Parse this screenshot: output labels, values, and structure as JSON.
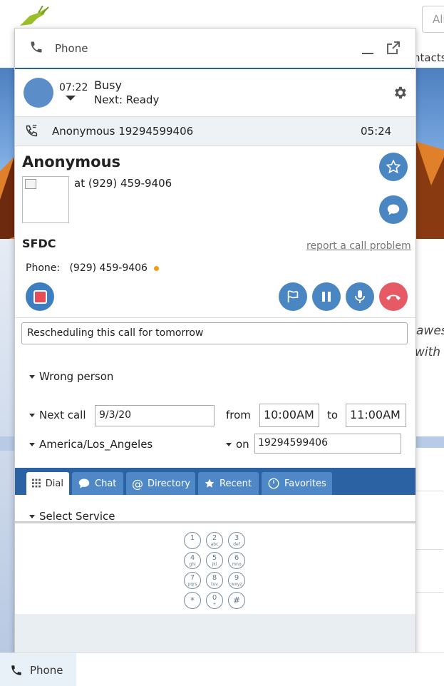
{
  "background": {
    "search_placeholder": "All",
    "nav_text": "ntacts",
    "italic_line1": "awes",
    "italic_line2": "with"
  },
  "softphone": {
    "title": "Phone",
    "agent": {
      "time": "07:22",
      "status": "Busy",
      "next_status": "Next: Ready"
    },
    "call": {
      "caller": "Anonymous 19294599406",
      "duration": "05:24"
    },
    "contact": {
      "name": "Anonymous",
      "number_line": "at (929) 459-9406",
      "source": "SFDC",
      "report_link": "report a call problem",
      "phone_label": "Phone:",
      "phone_value": "(929) 459-9406"
    },
    "notes_value": "Rescheduling this call for tomorrow",
    "disposition": "Wrong person",
    "callback": {
      "next_call_label": "Next call",
      "date": "9/3/20",
      "from_label": "from",
      "from_time": "10:00AM",
      "to_label": "to",
      "to_time": "11:00AM",
      "timezone": "America/Los_Angeles",
      "on_label": "on",
      "on_number": "19294599406"
    },
    "tabs": [
      {
        "label": "Dial",
        "icon": "grid-icon"
      },
      {
        "label": "Chat",
        "icon": "chat-bubble-icon"
      },
      {
        "label": "Directory",
        "icon": "at-icon"
      },
      {
        "label": "Recent",
        "icon": "star-icon"
      },
      {
        "label": "Favorites",
        "icon": "clock-icon"
      }
    ],
    "service_select": "Select Service",
    "keypad": [
      {
        "digit": "1",
        "letters": ""
      },
      {
        "digit": "2",
        "letters": "abc"
      },
      {
        "digit": "3",
        "letters": "def"
      },
      {
        "digit": "4",
        "letters": "ghi"
      },
      {
        "digit": "5",
        "letters": "jkl"
      },
      {
        "digit": "6",
        "letters": "mno"
      },
      {
        "digit": "7",
        "letters": "pqrs"
      },
      {
        "digit": "8",
        "letters": "tuv"
      },
      {
        "digit": "9",
        "letters": "wxyz"
      },
      {
        "digit": "*",
        "letters": ""
      },
      {
        "digit": "0",
        "letters": "+"
      },
      {
        "digit": "#",
        "letters": ""
      }
    ]
  },
  "taskbar": {
    "phone_label": "Phone"
  },
  "colors": {
    "accent": "#2a62a4",
    "button_blue": "#4a86c2",
    "hangup_red": "#e55a64",
    "record_red": "#e84c57",
    "presence_dot": "#f39c12"
  }
}
